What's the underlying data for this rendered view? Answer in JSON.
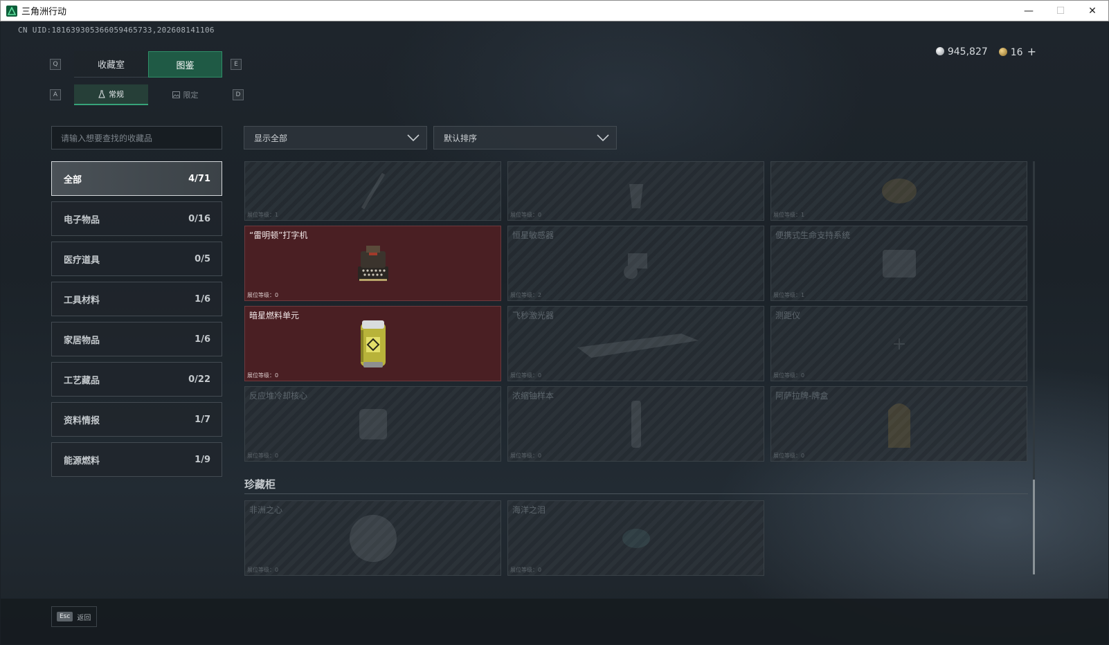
{
  "window": {
    "title": "三角洲行动",
    "minimize": "—",
    "maximize": "☐",
    "close": "✕"
  },
  "uid_text": "CN UID:181639305366059465733,202608141106",
  "currency": {
    "silver": "945,827",
    "gold": "16",
    "add": "+"
  },
  "keys": {
    "q": "Q",
    "e": "E",
    "a": "A",
    "d": "D"
  },
  "tabs_main": [
    {
      "label": "收藏室"
    },
    {
      "label": "图鉴",
      "active": true
    }
  ],
  "tabs_sub": [
    {
      "label": "常规",
      "active": true
    },
    {
      "label": "限定"
    }
  ],
  "search": {
    "placeholder": "请输入想要查找的收藏品"
  },
  "filters": {
    "show": "显示全部",
    "sort": "默认排序"
  },
  "categories": [
    {
      "label": "全部",
      "count": "4/71",
      "active": true
    },
    {
      "label": "电子物品",
      "count": "0/16"
    },
    {
      "label": "医疗道具",
      "count": "0/5"
    },
    {
      "label": "工具材料",
      "count": "1/6"
    },
    {
      "label": "家居物品",
      "count": "1/6"
    },
    {
      "label": "工艺藏品",
      "count": "0/22"
    },
    {
      "label": "资料情报",
      "count": "1/7"
    },
    {
      "label": "能源燃料",
      "count": "1/9"
    }
  ],
  "level_label": "展位等级：",
  "items_row0": [
    {
      "name": "",
      "level": "1"
    },
    {
      "name": "",
      "level": "0"
    },
    {
      "name": "",
      "level": "1"
    }
  ],
  "items_row1": [
    {
      "name": "“雷明顿”打字机",
      "level": "0",
      "owned": true
    },
    {
      "name": "恒星敏感器",
      "level": "2"
    },
    {
      "name": "便携式生命支持系统",
      "level": "1"
    }
  ],
  "items_row2": [
    {
      "name": "暗星燃料单元",
      "level": "0",
      "owned": true
    },
    {
      "name": "飞秒激光器",
      "level": "0"
    },
    {
      "name": "测距仪",
      "level": "0"
    }
  ],
  "items_row3": [
    {
      "name": "反应堆冷却核心",
      "level": "0"
    },
    {
      "name": "浓缩铀样本",
      "level": "0"
    },
    {
      "name": "阿萨拉牌-牌盒",
      "level": "0"
    }
  ],
  "cabinet": {
    "title": "珍藏柜",
    "items": [
      {
        "name": "非洲之心",
        "level": "0"
      },
      {
        "name": "海洋之泪",
        "level": "0"
      }
    ]
  },
  "footer": {
    "key": "Esc",
    "label": "返回"
  },
  "colors": {
    "accent": "#1f5a45",
    "owned_card": "#4a1f23",
    "background": "#1e252c"
  }
}
